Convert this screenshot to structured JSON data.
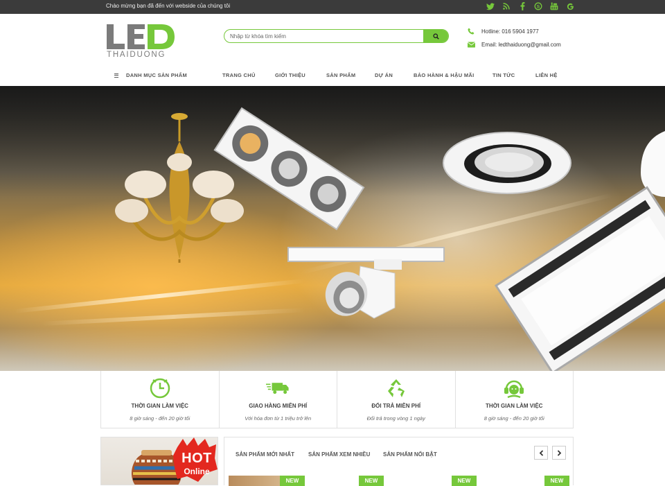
{
  "topbar": {
    "welcome": "Chào mừng bạn đã đến với webside của chúng tôi",
    "socials": [
      "twitter-icon",
      "rss-icon",
      "facebook-icon",
      "skype-icon",
      "youtube-icon",
      "google-icon"
    ]
  },
  "logo": {
    "line1": "LED",
    "line2": "THAIDUONG"
  },
  "search": {
    "placeholder": "Nhập từ khóa tìm kiếm",
    "value": ""
  },
  "contact": {
    "hotline": "Hotline: 016 5904 1977",
    "email": "Email: ledthaiduong@gmail.com"
  },
  "nav": {
    "category_menu": "DANH MỤC SẢN PHẨM",
    "items": [
      "TRANG CHỦ",
      "GIỚI THIỆU",
      "SẢN PHẨM",
      "DỰ ÁN",
      "BẢO HÀNH & HẬU MÃI",
      "TIN TỨC",
      "LIÊN HỆ"
    ]
  },
  "features": [
    {
      "icon": "clock-icon",
      "title": "THỜI GIAN LÀM VIỆC",
      "desc": "8 giờ sáng - đến 20 giờ tối"
    },
    {
      "icon": "delivery-truck-icon",
      "title": "GIAO HÀNG MIỄN PHÍ",
      "desc": "Với hóa đơn từ 1 triệu trở lên"
    },
    {
      "icon": "recycle-icon",
      "title": "ĐỔI TRẢ MIỄN PHÍ",
      "desc": "Đổi trả trong vòng 1 ngày"
    },
    {
      "icon": "headset-support-icon",
      "title": "THỜI GIAN LÀM VIỆC",
      "desc": "8 giờ sáng - đến 20 giờ tối"
    }
  ],
  "banner": {
    "hot": "HOT",
    "online": "Online"
  },
  "products": {
    "tabs": [
      "SẢN PHẨM MỚI NHẤT",
      "SẢN PHẨM XEM NHIỀU",
      "SẢN PHẨM NỔI BẬT"
    ],
    "badge": "NEW"
  },
  "colors": {
    "accent": "#76c83b",
    "topbar": "#3b3b3b",
    "hot_red": "#e3281f"
  }
}
